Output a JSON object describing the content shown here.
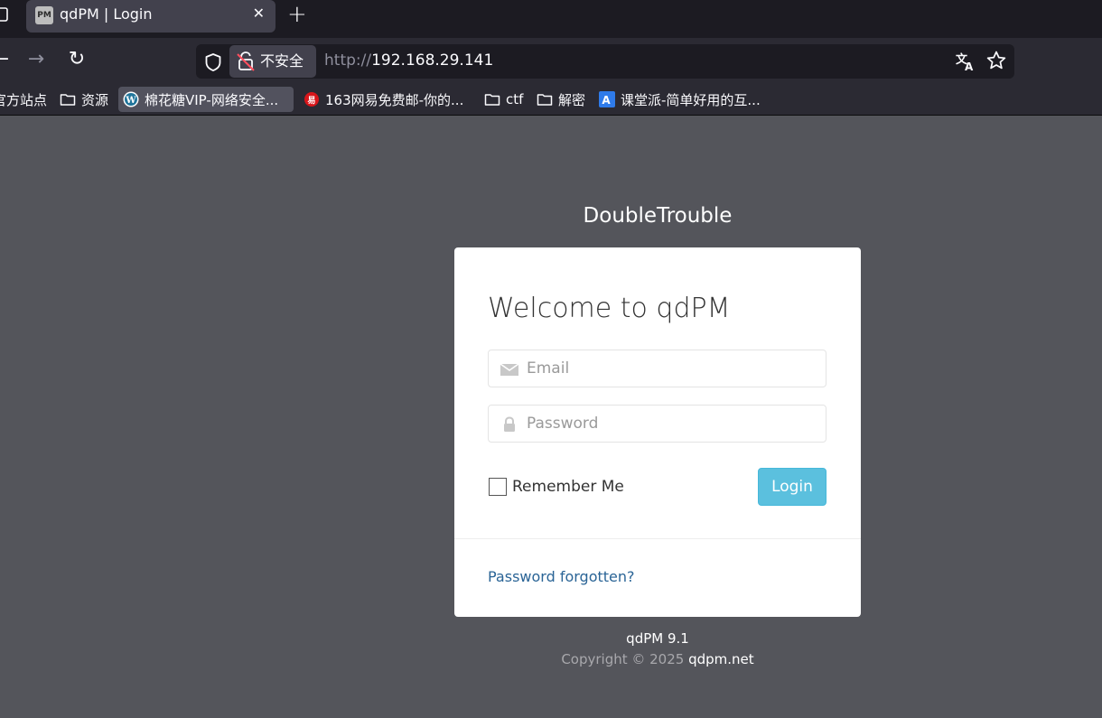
{
  "browser": {
    "tab": {
      "favicon_text": "PM",
      "title": "qdPM | Login",
      "close": "✕"
    },
    "new_tab": "+",
    "nav": {
      "back": "←",
      "forward": "→",
      "reload": "↻"
    },
    "security_label": "不安全",
    "url": {
      "scheme": "http://",
      "host": "192.168.29.141"
    },
    "bookmarks": [
      {
        "label": "官方站点",
        "icon": "none"
      },
      {
        "label": "资源",
        "icon": "folder-icon"
      },
      {
        "label": "棉花糖VIP-网络安全...",
        "icon": "wordpress-icon"
      },
      {
        "label": "163网易免费邮-你的...",
        "icon": "netease-icon"
      },
      {
        "label": "ctf",
        "icon": "folder-icon"
      },
      {
        "label": "解密",
        "icon": "folder-icon"
      },
      {
        "label": "课堂派-简单好用的互...",
        "icon": "ketangpai-icon"
      }
    ]
  },
  "page": {
    "site_name": "DoubleTrouble",
    "welcome": "Welcome to qdPM",
    "email_placeholder": "Email",
    "password_placeholder": "Password",
    "remember_label": "Remember Me",
    "login_label": "Login",
    "forgot_label": "Password forgotten?",
    "version": "qdPM 9.1",
    "copyright_prefix": "Copyright © 2025",
    "copyright_link": "qdpm.net"
  },
  "colors": {
    "background": "#54555b",
    "login_button": "#5bc0de",
    "link": "#2a6496"
  }
}
